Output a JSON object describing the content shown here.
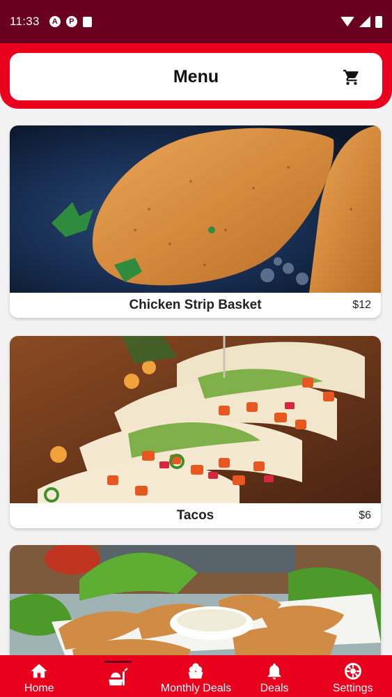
{
  "status_bar": {
    "time": "11:33",
    "left_icons": [
      "a-icon",
      "p-icon",
      "sd-card-icon"
    ],
    "right_icons": [
      "wifi-icon",
      "signal-icon",
      "battery-icon"
    ]
  },
  "header": {
    "title": "Menu",
    "cart_icon": "cart-icon"
  },
  "menu": {
    "items": [
      {
        "name": "Chicken Strip Basket",
        "price": "$12"
      },
      {
        "name": "Tacos",
        "price": "$6"
      },
      {
        "name": "",
        "price": ""
      }
    ]
  },
  "bottom_nav": {
    "items": [
      {
        "label": "Home",
        "icon": "home-icon"
      },
      {
        "label": "",
        "icon": "food-menu-icon",
        "active": true
      },
      {
        "label": "Monthly Deals",
        "icon": "deals-basket-icon"
      },
      {
        "label": "Deals",
        "icon": "bell-icon"
      },
      {
        "label": "Settings",
        "icon": "gear-icon"
      }
    ]
  },
  "colors": {
    "status_bar": "#6a0020",
    "brand_red": "#e8001c",
    "card_bg": "#ffffff",
    "page_bg": "#f2f2f2"
  }
}
